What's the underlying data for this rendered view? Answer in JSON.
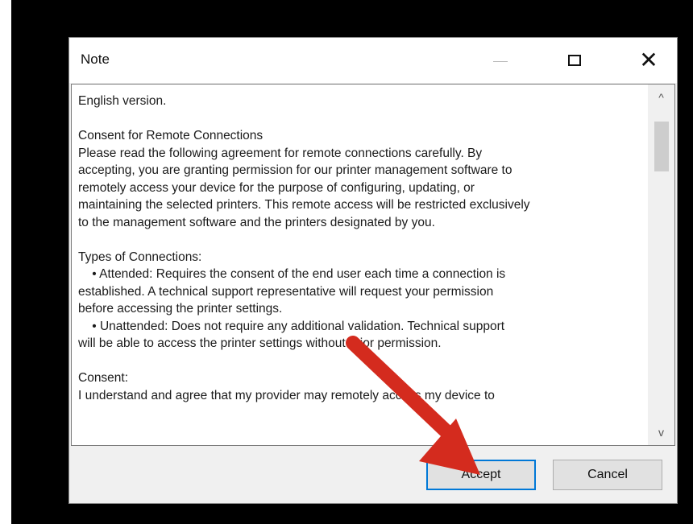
{
  "dialog": {
    "title": "Note",
    "close_glyph": "✕",
    "text": "English version.\n\nConsent for Remote Connections\nPlease read the following agreement for remote connections carefully. By\naccepting, you are granting permission for our printer management software to\nremotely access your device for the purpose of configuring, updating, or\nmaintaining the selected printers. This remote access will be restricted exclusively\nto the management software and the printers designated by you.\n\nTypes of Connections:\n    • Attended: Requires the consent of the end user each time a connection is\nestablished. A technical support representative will request your permission\nbefore accessing the printer settings.\n    • Unattended: Does not require any additional validation. Technical support\nwill be able to access the printer settings without prior permission.\n\nConsent:\nI understand and agree that my provider may remotely access my device to",
    "scroll_up_glyph": "^",
    "scroll_down_glyph": "v",
    "buttons": {
      "accept": "Accept",
      "cancel": "Cancel"
    }
  },
  "colors": {
    "annotation_arrow": "#d42b1e",
    "focus_border": "#0078d7"
  },
  "icons": [
    "minimize-icon",
    "maximize-icon",
    "close-icon",
    "scroll-up-icon",
    "scroll-down-icon",
    "annotation-arrow-icon"
  ]
}
